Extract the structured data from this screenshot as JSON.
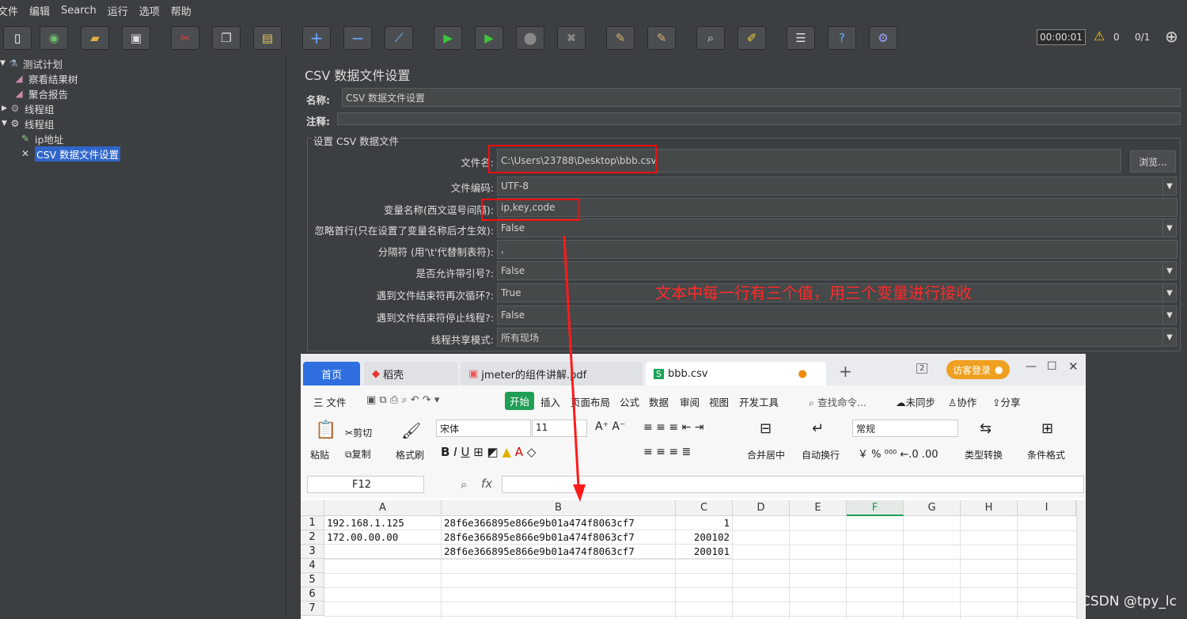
{
  "menu": [
    "文件",
    "编辑",
    "Search",
    "运行",
    "选项",
    "帮助"
  ],
  "toolbar": {
    "timer": "00:00:01",
    "warn_count": "0",
    "threads": "0/1"
  },
  "tree": {
    "items": [
      "测试计划",
      "察看结果树",
      "聚合报告",
      "线程组",
      "线程组",
      "ip地址",
      "CSV 数据文件设置"
    ]
  },
  "panel": {
    "title": "CSV 数据文件设置",
    "name_label": "名称:",
    "name_value": "CSV 数据文件设置",
    "comment_label": "注释:",
    "section": "设置 CSV 数据文件",
    "browse": "浏览...",
    "rows": [
      {
        "label": "文件名:",
        "value": "C:\\Users\\23788\\Desktop\\bbb.csv"
      },
      {
        "label": "文件编码:",
        "value": "UTF-8"
      },
      {
        "label": "变量名称(西文逗号间隔):",
        "value": "ip,key,code"
      },
      {
        "label": "忽略首行(只在设置了变量名称后才生效):",
        "value": "False"
      },
      {
        "label": "分隔符 (用'\\t'代替制表符):",
        "value": ","
      },
      {
        "label": "是否允许带引号?:",
        "value": "False"
      },
      {
        "label": "遇到文件结束符再次循环?:",
        "value": "True"
      },
      {
        "label": "遇到文件结束符停止线程?:",
        "value": "False"
      },
      {
        "label": "线程共享模式:",
        "value": "所有现场"
      }
    ]
  },
  "annotation": "文本中每一行有三个值，用三个变量进行接收",
  "wps": {
    "tabs": [
      "首页",
      "稻壳",
      "jmeter的组件讲解.pdf",
      "bbb.csv"
    ],
    "tab_count": "2",
    "login": "访客登录",
    "menu": [
      "三 文件",
      "开始",
      "插入",
      "页面布局",
      "公式",
      "数据",
      "审阅",
      "视图",
      "开发工具"
    ],
    "search": "查找命令...",
    "sync": "未同步",
    "collab": "协作",
    "share": "分享",
    "ribbon": {
      "paste": "粘贴",
      "cut": "剪切",
      "copy": "复制",
      "format_brush": "格式刷",
      "font": "宋体",
      "size": "11",
      "merge": "合并居中",
      "wrap": "自动换行",
      "numfmt": "常规",
      "typeconv": "类型转换",
      "condfmt": "条件格式"
    },
    "cell_ref": "F12",
    "fx": "fx",
    "columns": [
      "A",
      "B",
      "C",
      "D",
      "E",
      "F",
      "G",
      "H",
      "I"
    ],
    "row_numbers": [
      "1",
      "2",
      "3",
      "4",
      "5",
      "6",
      "7"
    ],
    "rows": [
      [
        "192.168.1.125",
        "28f6e366895e866e9b01a474f8063cf7",
        "1"
      ],
      [
        "172.00.00.00",
        "28f6e366895e866e9b01a474f8063cf7",
        "200102"
      ],
      [
        "",
        "28f6e366895e866e9b01a474f8063cf7",
        "200101"
      ]
    ]
  },
  "watermark": "CSDN @tpy_lc"
}
